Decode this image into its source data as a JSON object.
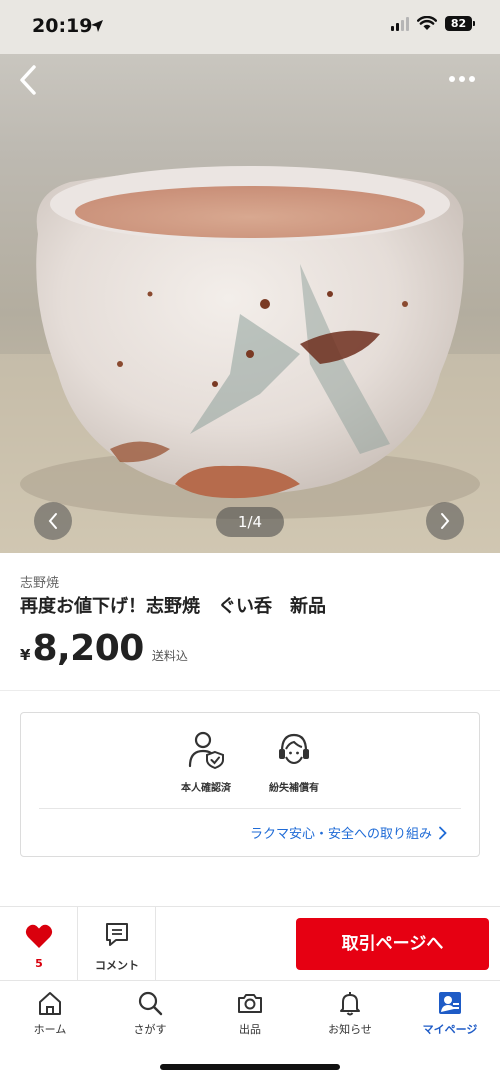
{
  "status_bar": {
    "time": "20:19",
    "battery": "82"
  },
  "gallery": {
    "counter": "1/4",
    "icons": {
      "back": "chevron-left-icon",
      "more": "more-horizontal-icon",
      "prev": "chevron-left-icon",
      "next": "chevron-right-icon"
    }
  },
  "product": {
    "brand": "志野焼",
    "title": "再度お値下げ！志野焼　ぐい呑　新品",
    "currency": "¥",
    "price": "8,200",
    "shipping": "送料込"
  },
  "safety": {
    "features": [
      {
        "icon": "identity-verified-icon",
        "label": "本人確認済"
      },
      {
        "icon": "support-headset-icon",
        "label": "紛失補償有"
      }
    ],
    "link_label": "ラクマ安心・安全への取り組み"
  },
  "actions": {
    "like_count": "5",
    "comment_label": "コメント",
    "trade_label": "取引ページへ",
    "accent_color": "#e60012"
  },
  "tabs": [
    {
      "icon": "home-icon",
      "label": "ホーム"
    },
    {
      "icon": "search-icon",
      "label": "さがす"
    },
    {
      "icon": "camera-icon",
      "label": "出品"
    },
    {
      "icon": "bell-icon",
      "label": "お知らせ"
    },
    {
      "icon": "mypage-icon",
      "label": "マイページ",
      "active": true
    }
  ]
}
